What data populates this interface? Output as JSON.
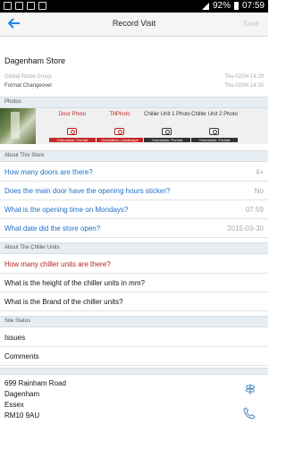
{
  "status_bar": {
    "battery": "92%",
    "time": "07:59"
  },
  "app_bar": {
    "title": "Record Visit",
    "save_label": "Save"
  },
  "store": {
    "name": "Dagenham Store",
    "group": "Global Retail Group",
    "group_date": "Thu 02/04 14:29",
    "format": "Format Changeover",
    "format_date": "Thu 02/04 14:30"
  },
  "photos_section": {
    "heading": "Photos",
    "items": [
      {
        "label": "Door Photo",
        "orientation": "Orientation: Portrait"
      },
      {
        "label": "TillPhoto",
        "orientation": "Orientation: Landscape"
      },
      {
        "label": "Chiller Unit 1 Photo",
        "orientation": "Orientation: Portrait"
      },
      {
        "label": "Chiller Unit 2 Photo",
        "orientation": "Orientation: Portrait"
      }
    ]
  },
  "about_store": {
    "heading": "About This Store",
    "questions": [
      {
        "q": "How many doors are there?",
        "a": "4+"
      },
      {
        "q": "Does the main door have the opening hours sticker?",
        "a": "No"
      },
      {
        "q": "What is the opening time on Mondays?",
        "a": "07:59"
      },
      {
        "q": "What date did the store open?",
        "a": "2015-03-30"
      }
    ]
  },
  "about_chillers": {
    "heading": "About The Chiller Units",
    "questions": [
      {
        "q": "How many chiller units are there?"
      },
      {
        "q": "What is the height of the chiller units in mm?"
      },
      {
        "q": "What is the Brand of the chiller units?"
      }
    ]
  },
  "site_status": {
    "heading": "Site Status",
    "items": [
      "Issues",
      "Comments"
    ]
  },
  "address": {
    "line1": "699 Rainham Road",
    "line2": "Dagenham",
    "line3": "Essex",
    "line4": "RM10 9AU"
  },
  "colors": {
    "accent": "#1e88e5",
    "link": "#1e6fc8",
    "required": "#b71c1c",
    "section_bg": "#e6edf3"
  }
}
